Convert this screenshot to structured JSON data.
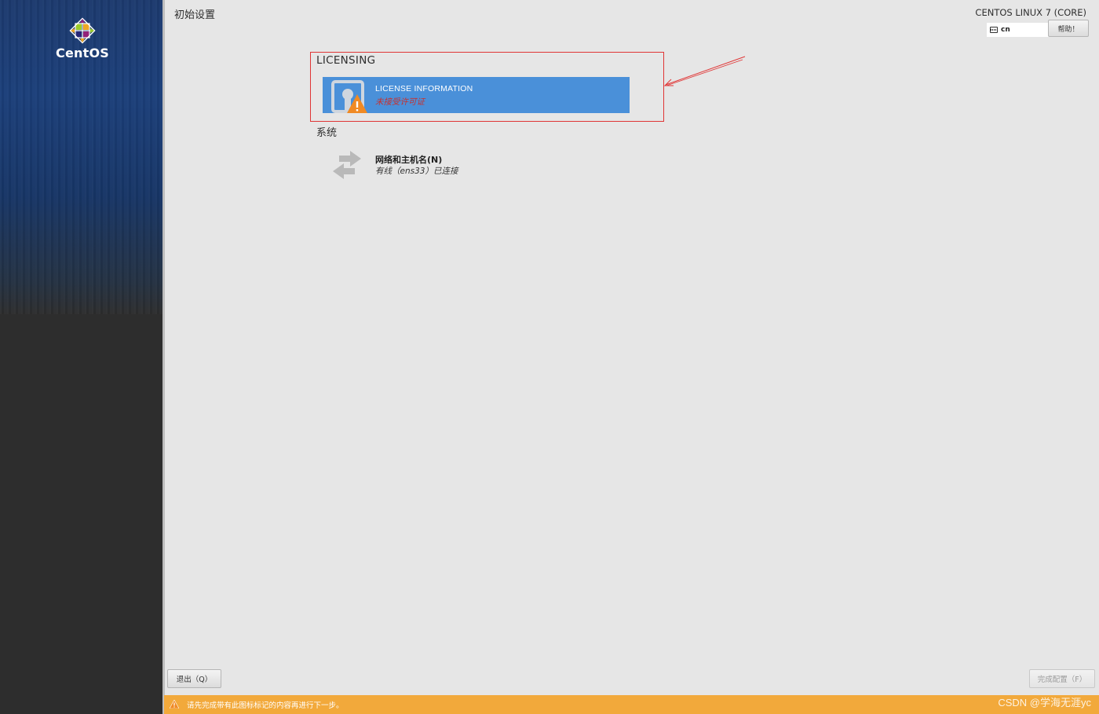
{
  "logo": {
    "text": "CentOS"
  },
  "header": {
    "page_title": "初始设置",
    "product_name": "CENTOS LINUX 7 (CORE)",
    "keyboard_layout": "cn",
    "help_label": "帮助！"
  },
  "sections": {
    "licensing": {
      "heading": "LICENSING",
      "items": [
        {
          "title": "LICENSE INFORMATION",
          "status": "未接受许可证",
          "icon": "license-warning-icon"
        }
      ]
    },
    "system": {
      "heading": "系统",
      "items": [
        {
          "title": "网络和主机名(N)",
          "status": "有线（ens33）已连接",
          "icon": "network-arrows-icon"
        }
      ]
    }
  },
  "footer": {
    "quit_label": "退出（Q）",
    "finish_label": "完成配置（F）",
    "warning_text": "请先完成带有此图标标记的内容再进行下一步。",
    "watermark": "CSDN @学海无涯yc"
  },
  "colors": {
    "tile_selected": "#4a90d9",
    "warning_bar": "#f2a93b",
    "status_error": "#c9302c",
    "highlight_box": "#e03535"
  }
}
